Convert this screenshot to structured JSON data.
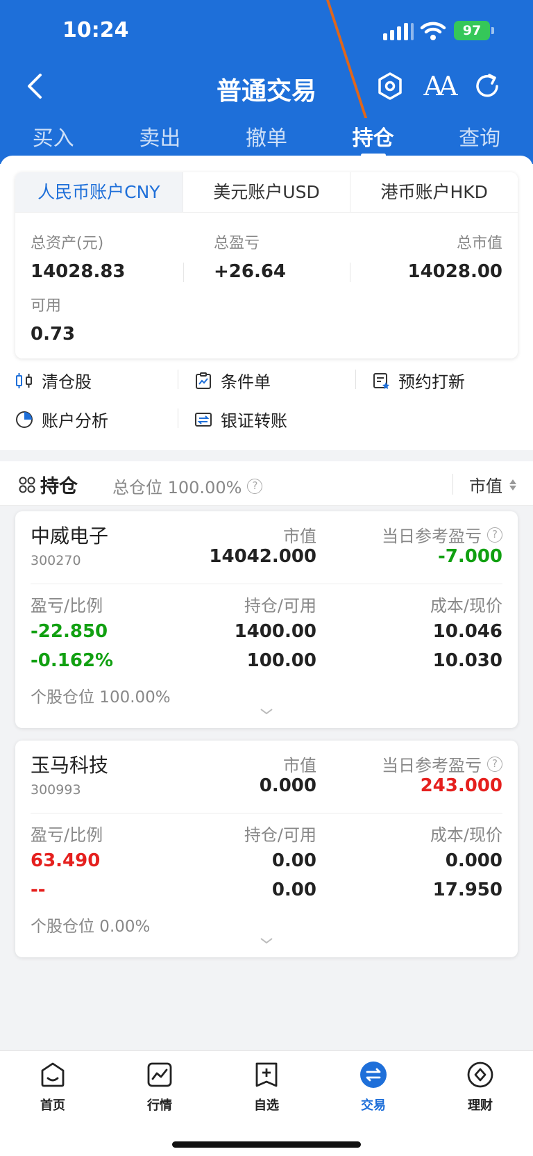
{
  "status": {
    "time": "10:24",
    "battery": "97"
  },
  "nav": {
    "title": "普通交易"
  },
  "tabs": [
    "买入",
    "卖出",
    "撤单",
    "持仓",
    "查询"
  ],
  "accounts": {
    "tabs": [
      "人民币账户CNY",
      "美元账户USD",
      "港币账户HKD"
    ],
    "total_assets_label": "总资产(元)",
    "total_assets": "14028.83",
    "total_pnl_label": "总盈亏",
    "total_pnl": "+26.64",
    "market_value_label": "总市值",
    "market_value": "14028.00",
    "available_label": "可用",
    "available": "0.73"
  },
  "menu": {
    "clear": "清仓股",
    "conditional": "条件单",
    "ipo": "预约打新",
    "analysis": "账户分析",
    "transfer": "银证转账"
  },
  "holdings": {
    "title": "持仓",
    "total_position": "总仓位 100.00%",
    "sort_label": "市值",
    "labels": {
      "market_value": "市值",
      "daily_pnl": "当日参考盈亏",
      "pnl_ratio": "盈亏/比例",
      "hold_avail": "持仓/可用",
      "cost_price": "成本/现价"
    },
    "stocks": [
      {
        "name": "中威电子",
        "code": "300270",
        "market_value": "14042.000",
        "daily_pnl": "-7.000",
        "pnl": "-22.850",
        "ratio": "-0.162%",
        "hold": "1400.00",
        "avail": "100.00",
        "cost": "10.046",
        "price": "10.030",
        "position": "个股仓位 100.00%"
      },
      {
        "name": "玉马科技",
        "code": "300993",
        "market_value": "0.000",
        "daily_pnl": "243.000",
        "pnl": "63.490",
        "ratio": "--",
        "hold": "0.00",
        "avail": "0.00",
        "cost": "0.000",
        "price": "17.950",
        "position": "个股仓位 0.00%"
      }
    ]
  },
  "bottom_nav": [
    "首页",
    "行情",
    "自选",
    "交易",
    "理财"
  ],
  "colors": {
    "brand": "#1e6fd9",
    "up": "#e5201e",
    "down": "#11a011"
  }
}
